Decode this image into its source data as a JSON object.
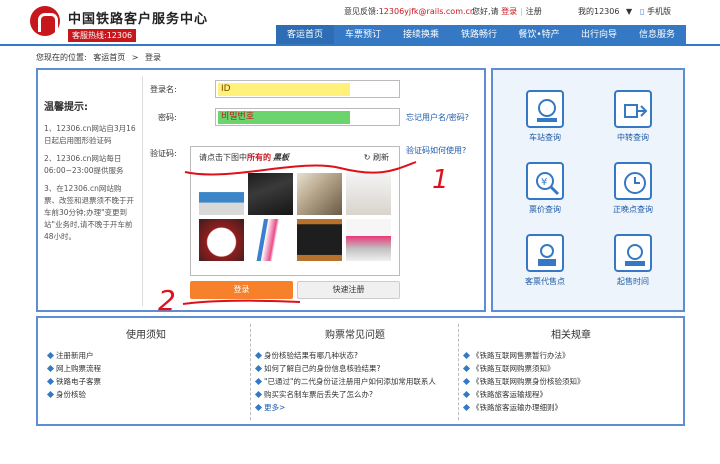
{
  "brand": {
    "title": "中国铁路客户服务中心",
    "hotline": "客服热线:12306"
  },
  "utility": {
    "feedback_label": "意见反馈:",
    "feedback_email": "12306yjfk@rails.com.cn",
    "greeting": "您好,请",
    "login": "登录",
    "register": "注册",
    "my12306": "我的12306",
    "mobile": "手机版"
  },
  "nav": {
    "items": [
      "客运首页",
      "车票预订",
      "接续换乘",
      "铁路畅行",
      "餐饮•特产",
      "出行向导",
      "信息服务"
    ]
  },
  "breadcrumb": {
    "prefix": "您现在的位置:",
    "home": "客运首页",
    "sep": ">",
    "current": "登录"
  },
  "tips": {
    "title": "温馨提示:",
    "items": [
      "1、12306.cn网站自3月16日起启用图形验证码",
      "2、12306.cn网站每日06:00~23:00提供服务",
      "3、在12306.cn网站购票、改签和退票须不晚于开车前30分钟;办理\"变更到站\"业务时,请不晚于开车前48小时。"
    ]
  },
  "login_form": {
    "username_label": "登录名:",
    "username_value": "ID",
    "password_label": "密码:",
    "password_value": "비밀번호",
    "forgot_link": "忘记用户名/密码?",
    "captcha_label": "验证码:",
    "captcha_help": "验证码如何使用?",
    "captcha_instruction_prefix": "请点击下图中",
    "captcha_instruction_bold": "所有的",
    "captcha_keyword": "黑板",
    "captcha_refresh": "刷新",
    "login_button": "登录",
    "register_button": "快速注册"
  },
  "quick": {
    "items": [
      {
        "label": "车站查询",
        "icon": "station-icon"
      },
      {
        "label": "中转查询",
        "icon": "transfer-icon"
      },
      {
        "label": "票价查询",
        "icon": "ticket-price-icon"
      },
      {
        "label": "正晚点查询",
        "icon": "clock-icon"
      },
      {
        "label": "客票代售点",
        "icon": "agency-icon"
      },
      {
        "label": "起售时间",
        "icon": "sale-time-icon"
      }
    ]
  },
  "info": {
    "columns": [
      {
        "title": "使用须知",
        "items": [
          "注册新用户",
          "网上购票流程",
          "铁路电子客票",
          "身份核验"
        ],
        "more": ""
      },
      {
        "title": "购票常见问题",
        "items": [
          "身份核验结果有哪几种状态?",
          "如何了解自己的身份信息核验结果?",
          "\"已通过\"的二代身份证注册用户如何添加常用联系人",
          "购买实名制车票后丢失了怎么办?"
        ],
        "more": "更多>"
      },
      {
        "title": "相关规章",
        "items": [
          "《铁路互联网售票暂行办法》",
          "《铁路互联网购票须知》",
          "《铁路互联网购票身份核验须知》",
          "《铁路旅客运输规程》",
          "《铁路旅客运输办理细则》"
        ],
        "more": ""
      }
    ]
  },
  "annotations": {
    "mark1": "1",
    "mark2": "2"
  },
  "colors": {
    "brand_red": "#c8161d",
    "nav_blue": "#3578c4",
    "login_orange": "#f7812a",
    "annotation_red": "#e0101a"
  }
}
